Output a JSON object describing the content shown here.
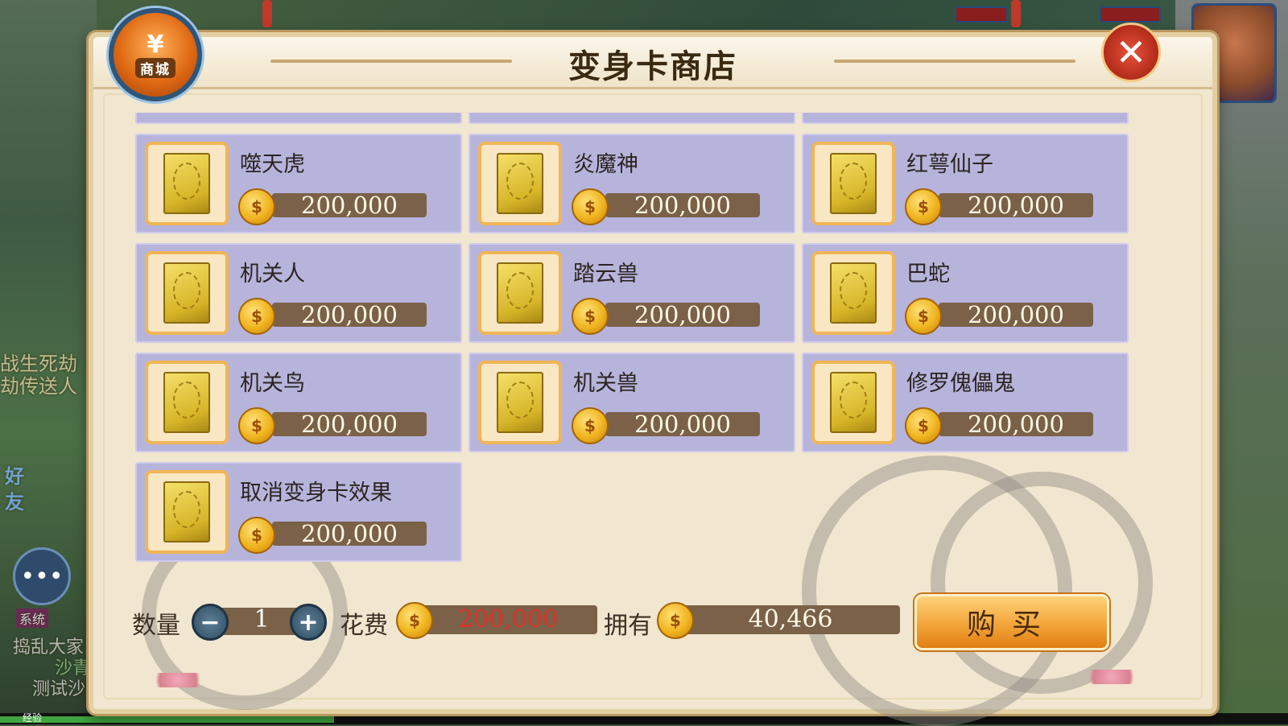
{
  "hud": {
    "left_texts": [
      "战生死劫",
      "劫传送人",
      "好",
      "友"
    ],
    "system_tag": "系统",
    "chat_lines": [
      "捣乱大家",
      "沙青",
      "测试沙包"
    ],
    "exp_label": "经验"
  },
  "shop": {
    "badge_symbol": "¥",
    "badge_label": "商城",
    "title": "变身卡商店",
    "close_label": "✕",
    "currency_icon": "gold-coin-icon",
    "items": [
      {
        "name": "噬天虎",
        "price": "200,000"
      },
      {
        "name": "炎魔神",
        "price": "200,000"
      },
      {
        "name": "红萼仙子",
        "price": "200,000"
      },
      {
        "name": "机关人",
        "price": "200,000"
      },
      {
        "name": "踏云兽",
        "price": "200,000"
      },
      {
        "name": "巴蛇",
        "price": "200,000"
      },
      {
        "name": "机关鸟",
        "price": "200,000"
      },
      {
        "name": "机关兽",
        "price": "200,000"
      },
      {
        "name": "修罗傀儡鬼",
        "price": "200,000"
      },
      {
        "name": "取消变身卡效果",
        "price": "200,000"
      }
    ]
  },
  "purchase": {
    "quantity_label": "数量",
    "minus": "−",
    "quantity": "1",
    "plus": "+",
    "cost_label": "花费",
    "cost": "200,000",
    "cost_color": "#e0302a",
    "own_label": "拥有",
    "owned": "40,466",
    "buy_label": "购买"
  }
}
